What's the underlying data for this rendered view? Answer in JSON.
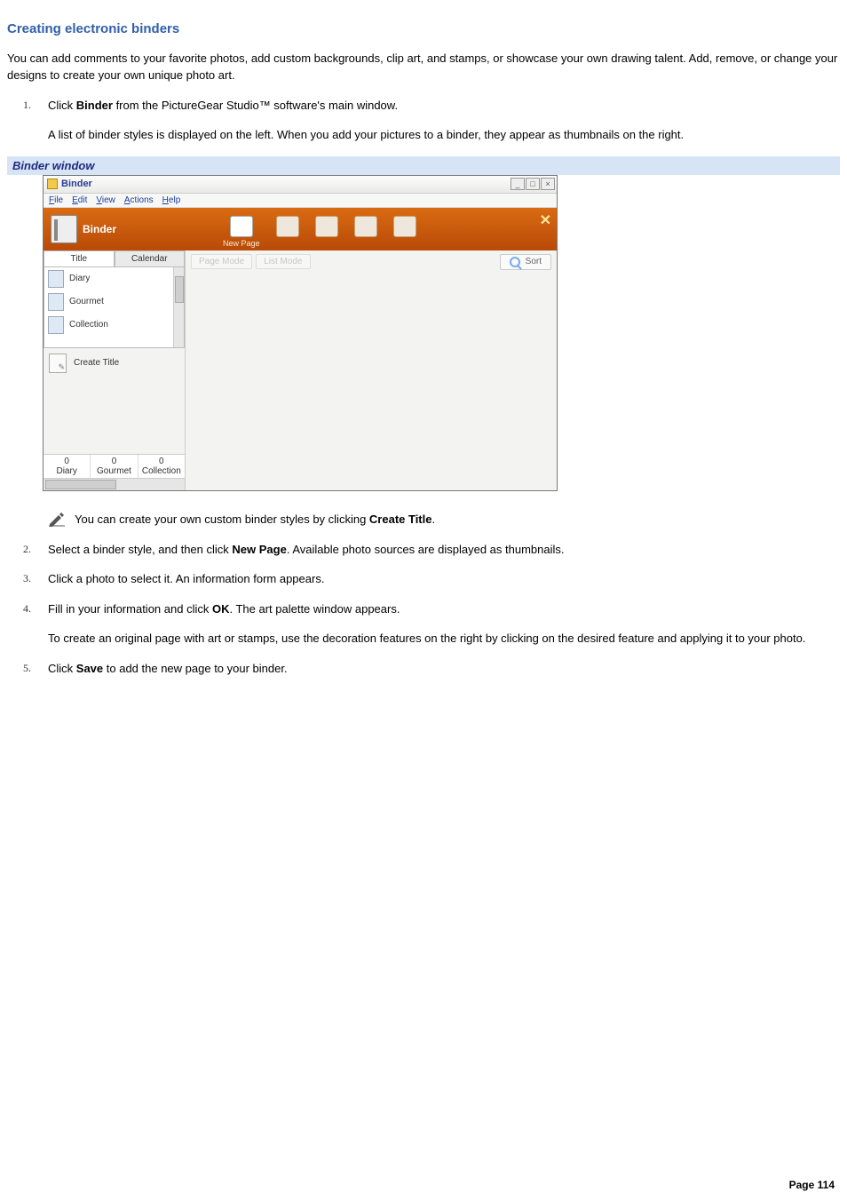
{
  "title": "Creating electronic binders",
  "intro": "You can add comments to your favorite photos, add custom backgrounds, clip art, and stamps, or showcase your own drawing talent. Add, remove, or change your designs to create your own unique photo art.",
  "steps": {
    "s1": {
      "num": "1.",
      "pre": "Click ",
      "bold": "Binder",
      "post": " from the PictureGear Studio™ software's main window.",
      "sub": "A list of binder styles is displayed on the left. When you add your pictures to a binder, they appear as thumbnails on the right."
    },
    "s2": {
      "num": "2.",
      "pre": "Select a binder style, and then click ",
      "bold": "New Page",
      "post": ". Available photo sources are displayed as thumbnails."
    },
    "s3": {
      "num": "3.",
      "text": "Click a photo to select it. An information form appears."
    },
    "s4": {
      "num": "4.",
      "pre": "Fill in your information and click ",
      "bold": "OK",
      "post": ". The art palette window appears.",
      "sub": "To create an original page with art or stamps, use the decoration features on the right by clicking on the desired feature and applying it to your photo."
    },
    "s5": {
      "num": "5.",
      "pre": "Click ",
      "bold": "Save",
      "post": " to add the new page to your binder."
    }
  },
  "caption": "Binder window",
  "note": {
    "pre": "You can create your own custom binder styles by clicking ",
    "bold": "Create Title",
    "post": "."
  },
  "screenshot": {
    "title": "Binder",
    "menu": {
      "file": "File",
      "edit": "Edit",
      "view": "View",
      "actions": "Actions",
      "help": "Help"
    },
    "toolbar": {
      "label": "Binder",
      "newpage": "New Page",
      "tools_x": "✕"
    },
    "left": {
      "tabs": {
        "title": "Title",
        "calendar": "Calendar"
      },
      "items": [
        "Diary",
        "Gourmet",
        "Collection"
      ],
      "create": "Create Title",
      "counts": [
        {
          "n": "0",
          "label": "Diary"
        },
        {
          "n": "0",
          "label": "Gourmet"
        },
        {
          "n": "0",
          "label": "Collection"
        }
      ]
    },
    "right": {
      "pagemode": "Page Mode",
      "listmode": "List Mode",
      "sort": "Sort"
    }
  },
  "footer": {
    "label": "Page ",
    "num": "114"
  }
}
